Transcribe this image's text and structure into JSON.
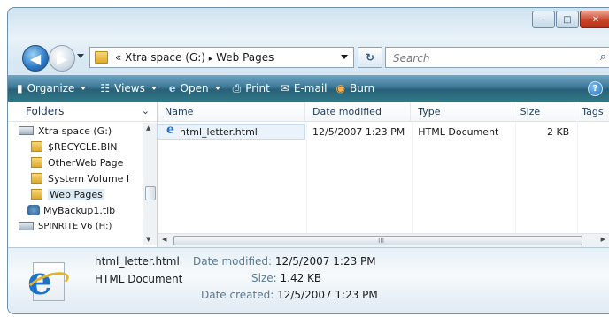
{
  "window": {
    "caption": {
      "minimize": "–",
      "maximize": "□",
      "close": "✕"
    }
  },
  "nav": {
    "back": "◀",
    "forward": "▶"
  },
  "address": {
    "prefix": "«",
    "path1": "Xtra space (G:)",
    "separator": "▸",
    "path2": "Web Pages"
  },
  "search": {
    "placeholder": "Search",
    "icon": "⌕"
  },
  "toolbar": {
    "organize": "Organize",
    "views": "Views",
    "open": "Open",
    "print": "Print",
    "email": "E-mail",
    "burn": "Burn",
    "help": "?"
  },
  "folders": {
    "header": "Folders",
    "items": [
      {
        "label": "Xtra space (G:)",
        "kind": "drive"
      },
      {
        "label": "$RECYCLE.BIN",
        "kind": "folder"
      },
      {
        "label": "OtherWeb Page",
        "kind": "folder"
      },
      {
        "label": "System Volume I",
        "kind": "folder"
      },
      {
        "label": "Web Pages",
        "kind": "folder"
      },
      {
        "label": "MyBackup1.tib",
        "kind": "file"
      },
      {
        "label": "SPINRITE V6 (H:)",
        "kind": "drive"
      }
    ]
  },
  "columns": {
    "name": "Name",
    "date": "Date modified",
    "type": "Type",
    "size": "Size",
    "tags": "Tags"
  },
  "files": [
    {
      "name": "html_letter.html",
      "date": "12/5/2007 1:23 PM",
      "type": "HTML Document",
      "size": "2 KB"
    }
  ],
  "details": {
    "name": "html_letter.html",
    "type": "HTML Document",
    "date_modified_label": "Date modified:",
    "date_modified": "12/5/2007 1:23 PM",
    "size_label": "Size:",
    "size": "1.42 KB",
    "date_created_label": "Date created:",
    "date_created": "12/5/2007 1:23 PM"
  },
  "scroll": {
    "grip": "III"
  },
  "colors": {
    "toolbar": "#2a6079",
    "accent": "#1d6fc8",
    "close": "#c9442a"
  }
}
